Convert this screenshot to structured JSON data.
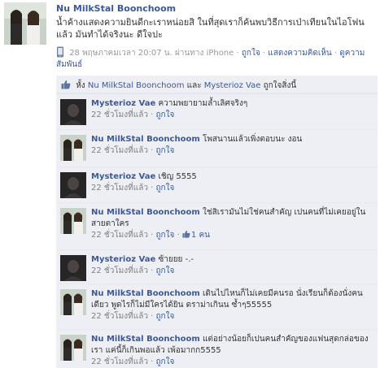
{
  "post": {
    "author": "Nu MilkStal Boonchoom",
    "text": "น้ำค้างแสดงความยินดีกะเราหน่อยสิ ในที่สุดเราก็ค้นพบวิธีการเป่าเทียนในไอโฟนแล้ว มันทำได้จริงนะ ดีใจปะ",
    "meta": {
      "timestamp": "28 พฤษภาคมเวลา 20:07 น. ผ่านทาง iPhone",
      "sep": "·",
      "like": "ถูกใจ",
      "comment": "แสดงความคิดเห็น",
      "relations": "ดูความสัมพันธ์"
    }
  },
  "likes": {
    "prefix": "หั้ง",
    "user1": "Nu MilkStal Boonchoom",
    "and": "และ",
    "user2": "Mysterioz Vae",
    "suffix": "ถูกใจสิ่งนี้"
  },
  "comments": [
    {
      "author": "Mysterioz Vae",
      "text": "ความพยายามล้ำเลิศจริงๆ",
      "time": "22 ชั่วโมงที่แล้ว",
      "sep": "·",
      "like": "ถูกใจ",
      "avatar": "dark"
    },
    {
      "author": "Nu MilkStal Boonchoom",
      "text": "โพสนานแล้วเพิ่งตอบนะ งอน",
      "time": "22 ชั่วโมงที่แล้ว",
      "sep": "·",
      "like": "ถูกใจ",
      "avatar": "photo"
    },
    {
      "author": "Mysterioz Vae",
      "text": "เชิญ 5555",
      "time": "22 ชั่วโมงที่แล้ว",
      "sep": "·",
      "like": "ถูกใจ",
      "avatar": "dark"
    },
    {
      "author": "Nu MilkStal Boonchoom",
      "text": "ใช่สิเรามันไม่ใช่คนสำคัญ เปนคนที่ไม่เคยอยู่ในสายตาใคร",
      "time": "22 ชั่วโมงที่แล้ว",
      "sep": "·",
      "like": "ถูกใจ",
      "likes_count": "1 คน",
      "avatar": "photo"
    },
    {
      "author": "Mysterioz Vae",
      "text": "ซ้ายยย -.-",
      "time": "22 ชั่วโมงที่แล้ว",
      "sep": "·",
      "like": "ถูกใจ",
      "avatar": "dark"
    },
    {
      "author": "Nu MilkStal Boonchoom",
      "text": "เดินไปไหนก็ไม่เคยมีคนรอ นั่งเรียนก็ต้องนั่งคนเดียว พูดไรก็ไม่มีใครได้ยิน ดราม่าเกินน ซ้ำๆ55555",
      "time": "22 ชั่วโมงที่แล้ว",
      "sep": "·",
      "like": "ถูกใจ",
      "avatar": "photo"
    },
    {
      "author": "Nu MilkStal Boonchoom",
      "text": "แต่อย่างน้อยก็เปนคนสำคัญของแฟนสุดกล่อของเรา แค่นี้ก็เกินพอแล้ว เพ้อมากก5555",
      "time": "22 ชั่วโมงที่แล้ว",
      "sep": "·",
      "like": "ถูกใจ",
      "avatar": "photo"
    }
  ],
  "colors": {
    "link": "#3b5998",
    "feedback_bg": "#edeff4",
    "meta_gray": "#999999"
  },
  "icons": {
    "phone": "mobile-phone-icon",
    "thumb": "thumbs-up-icon"
  }
}
